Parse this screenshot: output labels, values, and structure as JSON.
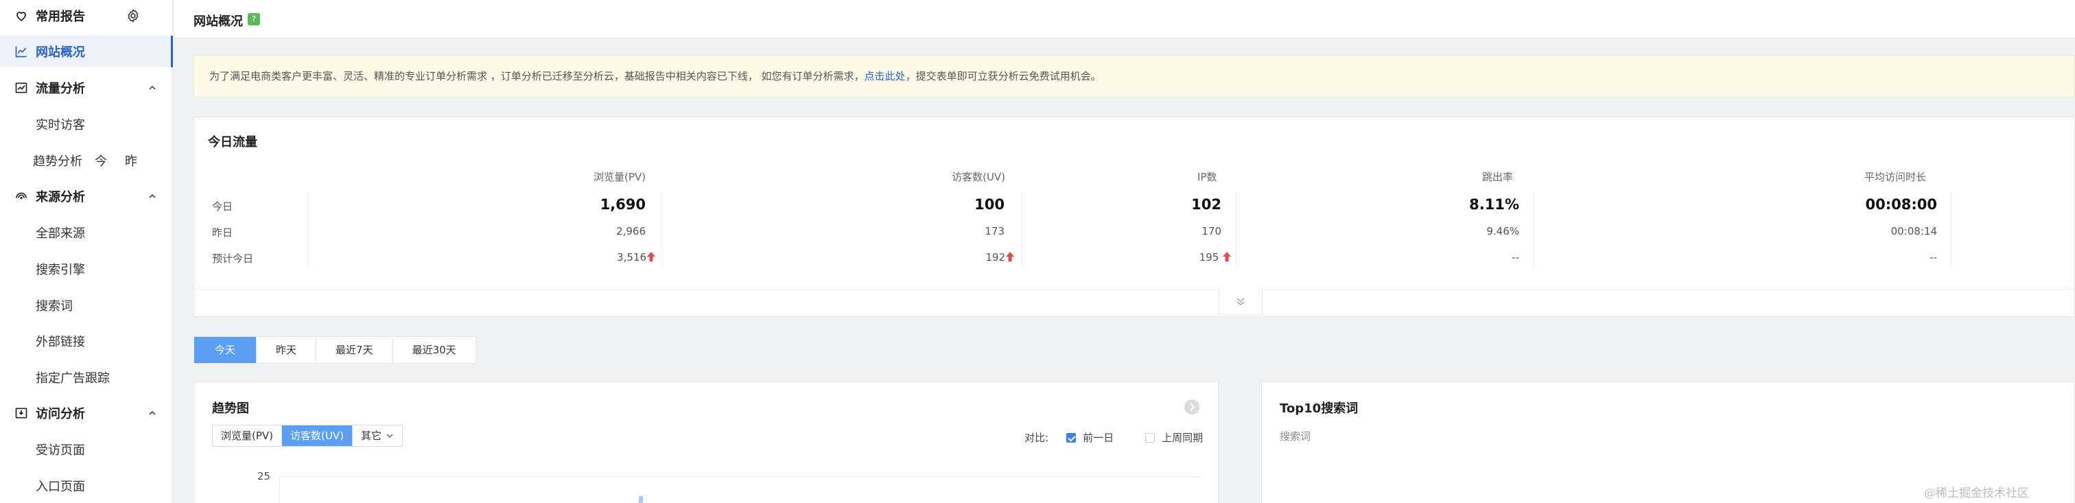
{
  "sidebar": {
    "favorites": {
      "label": "常用报告"
    },
    "overview": {
      "label": "网站概况"
    },
    "traffic": {
      "label": "流量分析",
      "items": [
        "实时访客",
        "趋势分析"
      ],
      "trend_today": "今",
      "trend_yesterday": "昨"
    },
    "source": {
      "label": "来源分析",
      "items": [
        "全部来源",
        "搜索引擎",
        "搜索词",
        "外部链接",
        "指定广告跟踪"
      ]
    },
    "visit": {
      "label": "访问分析",
      "items": [
        "受访页面",
        "入口页面"
      ]
    }
  },
  "header": {
    "title": "网站概况",
    "help": "?"
  },
  "notice": {
    "text_before": "为了满足电商类客户更丰富、灵活、精准的专业订单分析需求 ，订单分析已迁移至分析云，基础报告中相关内容已下线， 如您有订单分析需求，",
    "link": "点击此处",
    "text_after": "，提交表单即可立获分析云免费试用机会。"
  },
  "traffic": {
    "title": "今日流量",
    "columns": [
      "浏览量(PV)",
      "访客数(UV)",
      "IP数",
      "跳出率",
      "平均访问时长"
    ],
    "rows": [
      {
        "label": "今日",
        "values": [
          "1,690",
          "100",
          "102",
          "8.11%",
          "00:08:00"
        ]
      },
      {
        "label": "昨日",
        "values": [
          "2,966",
          "173",
          "170",
          "9.46%",
          "00:08:14"
        ]
      },
      {
        "label": "预计今日",
        "values": [
          "3,516",
          "192",
          "195",
          "--",
          "--"
        ]
      }
    ]
  },
  "period_tabs": [
    "今天",
    "昨天",
    "最近7天",
    "最近30天"
  ],
  "trend": {
    "title": "趋势图",
    "metric_tabs": [
      "浏览量(PV)",
      "访客数(UV)",
      "其它"
    ],
    "compare_label": "对比:",
    "compare_options": [
      "前一日",
      "上周同期"
    ],
    "y_tick": "25"
  },
  "top10": {
    "title": "Top10搜索词",
    "column": "搜索词"
  },
  "watermark": "@稀土掘金技术社区",
  "colors": {
    "accent": "#2b62c4",
    "tab_active": "#5b9ff2",
    "up_arrow": "#e04b4b",
    "notice_bg": "#fdfbe7"
  }
}
